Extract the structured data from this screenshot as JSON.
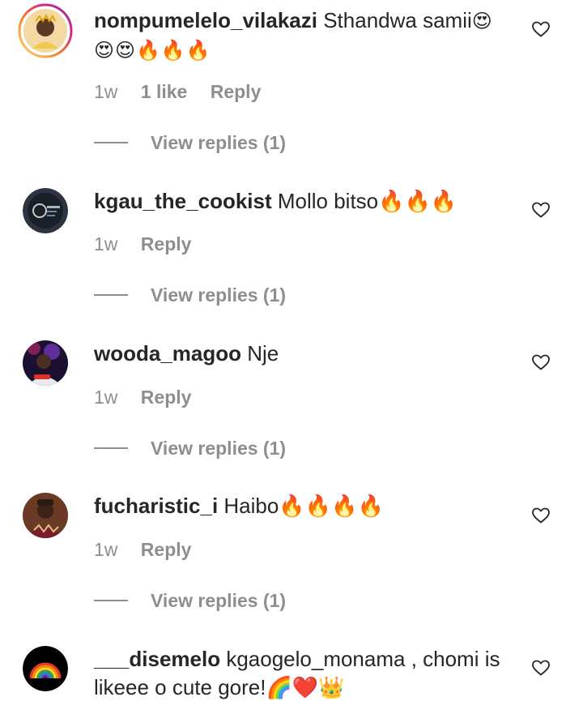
{
  "comments": [
    {
      "username": "nompumelelo_vilakazi",
      "text": " Sthandwa samii",
      "emoji_inline": "😍",
      "text_line2": "😍😍🔥🔥🔥",
      "time": "1w",
      "likes": "1 like",
      "reply": "Reply",
      "view_replies": "View replies (1)"
    },
    {
      "username": "kgau_the_cookist",
      "text": " Mollo bitso🔥🔥🔥",
      "time": "1w",
      "reply": "Reply",
      "view_replies": "View replies (1)"
    },
    {
      "username": "wooda_magoo",
      "text": " Nje",
      "time": "1w",
      "reply": "Reply",
      "view_replies": "View replies (1)"
    },
    {
      "username": "fucharistic_i",
      "text": " Haibo🔥🔥🔥🔥",
      "time": "1w",
      "reply": "Reply",
      "view_replies": "View replies (1)"
    },
    {
      "username": "___disemelo",
      "text": " kgaogelo_monama , chomi is",
      "text_line2": "likeee o cute gore!🌈❤️👑"
    }
  ],
  "icons": {
    "like": "heart-outline-icon"
  },
  "colors": {
    "story_ring_start": "#f58529",
    "story_ring_end": "#dd2a7b",
    "secondary_text": "#8e8e8e"
  }
}
